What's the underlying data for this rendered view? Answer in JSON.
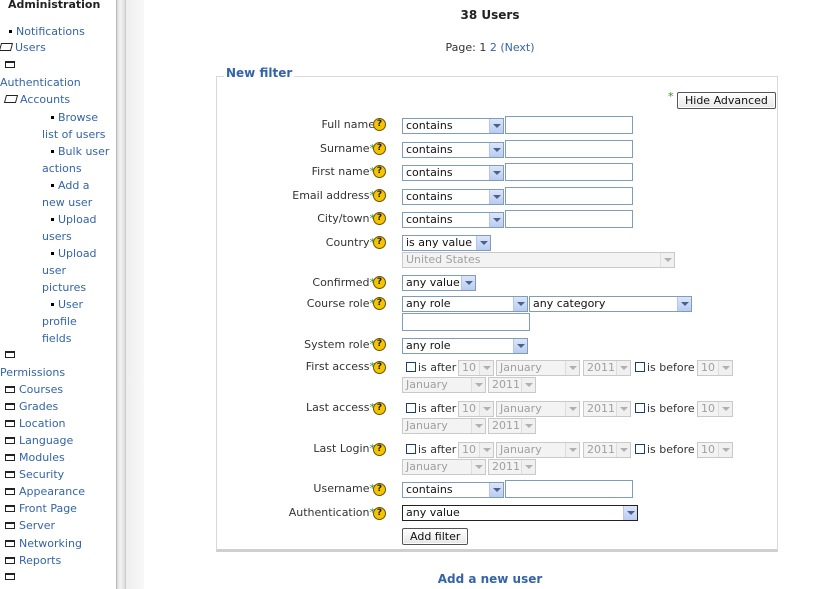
{
  "sidebar": {
    "title": "Administration",
    "items": [
      {
        "label": "Notifications"
      },
      {
        "label": "Users"
      },
      {
        "label": ""
      },
      {
        "label": "Authentication"
      },
      {
        "label": "Accounts"
      },
      {
        "label": "Browse"
      },
      {
        "label": "list of users"
      },
      {
        "label": "Bulk user"
      },
      {
        "label": "actions"
      },
      {
        "label": "Add a"
      },
      {
        "label": "new user"
      },
      {
        "label": "Upload"
      },
      {
        "label": "users"
      },
      {
        "label": "Upload"
      },
      {
        "label": "user"
      },
      {
        "label": "pictures"
      },
      {
        "label": "User"
      },
      {
        "label": "profile"
      },
      {
        "label": "fields"
      },
      {
        "label": ""
      },
      {
        "label": "Permissions"
      },
      {
        "label": "Courses"
      },
      {
        "label": "Grades"
      },
      {
        "label": "Location"
      },
      {
        "label": "Language"
      },
      {
        "label": "Modules"
      },
      {
        "label": "Security"
      },
      {
        "label": "Appearance"
      },
      {
        "label": "Front Page"
      },
      {
        "label": "Server"
      },
      {
        "label": "Networking"
      },
      {
        "label": "Reports"
      },
      {
        "label": ""
      }
    ]
  },
  "main": {
    "users_count": "38 Users",
    "pager": {
      "label": "Page:",
      "current": "1",
      "next_page": "2",
      "next_label": "(Next)"
    },
    "filter": {
      "legend": "New filter",
      "required_marker": "*",
      "advanced_button": "Hide Advanced",
      "help_glyph": "?",
      "rows": {
        "full_name": {
          "label": "Full name",
          "operator": "contains"
        },
        "surname": {
          "label": "Surname",
          "operator": "contains"
        },
        "first_name": {
          "label": "First name",
          "operator": "contains"
        },
        "email": {
          "label": "Email address",
          "operator": "contains"
        },
        "city": {
          "label": "City/town",
          "operator": "contains"
        },
        "country": {
          "label": "Country",
          "operator": "is any value",
          "value": "United States"
        },
        "confirmed": {
          "label": "Confirmed",
          "operator": "any value"
        },
        "course_role": {
          "label": "Course role",
          "role": "any role",
          "category": "any category"
        },
        "system_role": {
          "label": "System role",
          "operator": "any role"
        },
        "first_access": {
          "label": "First access"
        },
        "last_access": {
          "label": "Last access"
        },
        "last_login": {
          "label": "Last Login"
        },
        "username": {
          "label": "Username",
          "operator": "contains"
        },
        "authentication": {
          "label": "Authentication",
          "operator": "any value"
        }
      },
      "date": {
        "is_after": "is after",
        "is_before": "is before",
        "day": "10",
        "month": "January",
        "year": "2011"
      },
      "add_filter_button": "Add filter"
    },
    "add_user_title": "Add a new user"
  },
  "colors": {
    "link": "#3464a8",
    "required": "#2f8c2f",
    "help_icon": "#f5c400"
  }
}
